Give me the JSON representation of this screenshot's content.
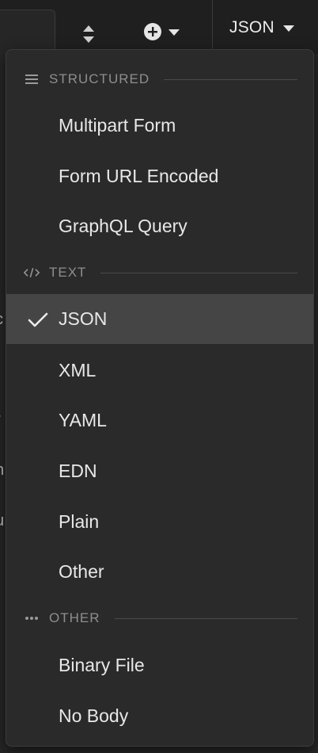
{
  "toolbar": {
    "body_type_label": "JSON",
    "sort_icon": "sort-arrows-icon",
    "add_icon": "plus-circle-icon",
    "chevron_icon": "caret-down-icon"
  },
  "dropdown": {
    "sections": [
      {
        "label": "STRUCTURED",
        "icon": "hamburger-lines-icon",
        "items": [
          {
            "label": "Multipart Form"
          },
          {
            "label": "Form URL Encoded"
          },
          {
            "label": "GraphQL Query"
          }
        ]
      },
      {
        "label": "TEXT",
        "icon": "code-brackets-icon",
        "items": [
          {
            "label": "JSON",
            "selected": true
          },
          {
            "label": "XML"
          },
          {
            "label": "YAML"
          },
          {
            "label": "EDN"
          },
          {
            "label": "Plain"
          },
          {
            "label": "Other"
          }
        ]
      },
      {
        "label": "OTHER",
        "icon": "ellipsis-icon",
        "items": [
          {
            "label": "Binary File"
          },
          {
            "label": "No Body"
          }
        ]
      }
    ]
  },
  "colors": {
    "menu_bg": "#2a2a2a",
    "selected_bg": "#454545",
    "section_text": "#8e8e8e",
    "item_text": "#e8e8e8"
  }
}
